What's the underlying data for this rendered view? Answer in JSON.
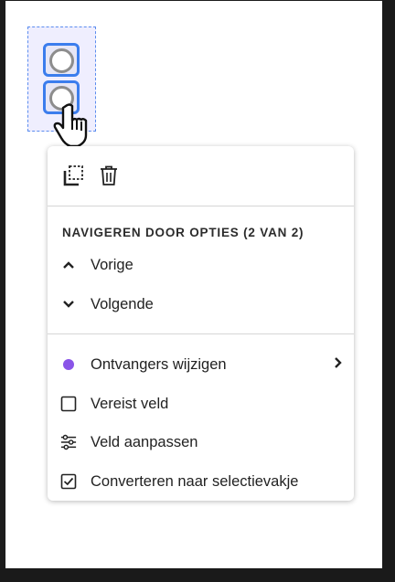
{
  "menu": {
    "section_title": "NAVIGEREN DOOR OPTIES (2 VAN 2)",
    "nav_items": [
      {
        "label": "Vorige",
        "icon": "chevron-up-icon"
      },
      {
        "label": "Volgende",
        "icon": "chevron-down-icon"
      }
    ],
    "actions": [
      {
        "label": "Ontvangers wijzigen",
        "icon": "recipient-dot-icon",
        "has_submenu": true
      },
      {
        "label": "Vereist veld",
        "icon": "checkbox-empty-icon"
      },
      {
        "label": "Veld aanpassen",
        "icon": "sliders-icon"
      },
      {
        "label": "Converteren naar selectievakje",
        "icon": "checkbox-checked-icon"
      }
    ],
    "toolbar_icons": [
      "duplicate-icon",
      "trash-icon"
    ]
  },
  "colors": {
    "recipient_dot": "#8a54e8",
    "selection_border": "#3b7ded"
  }
}
